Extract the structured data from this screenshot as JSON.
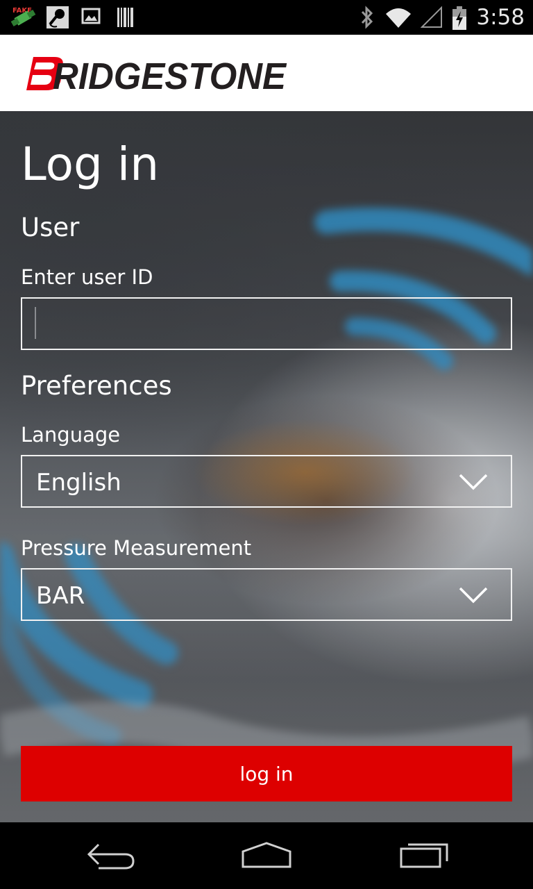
{
  "status_bar": {
    "time": "3:58",
    "left_icons": [
      "fake-gps-icon",
      "microphone-icon",
      "image-icon",
      "barcode-icon"
    ],
    "right_icons": [
      "bluetooth-icon",
      "wifi-icon",
      "signal-icon",
      "battery-charging-icon"
    ]
  },
  "app_bar": {
    "logo_text": "BRIDGESTONE",
    "brand_color": "#231f20",
    "accent_color": "#e60012"
  },
  "form": {
    "title": "Log in",
    "user_section": "User",
    "user_id_label": "Enter user ID",
    "user_id_value": "",
    "preferences_section": "Preferences",
    "language_label": "Language",
    "language_value": "English",
    "pressure_label": "Pressure Measurement",
    "pressure_value": "BAR",
    "login_button": "log in",
    "login_button_color": "#dd0000"
  },
  "nav_bar": {
    "buttons": [
      "back-icon",
      "home-icon",
      "recent-apps-icon"
    ]
  }
}
